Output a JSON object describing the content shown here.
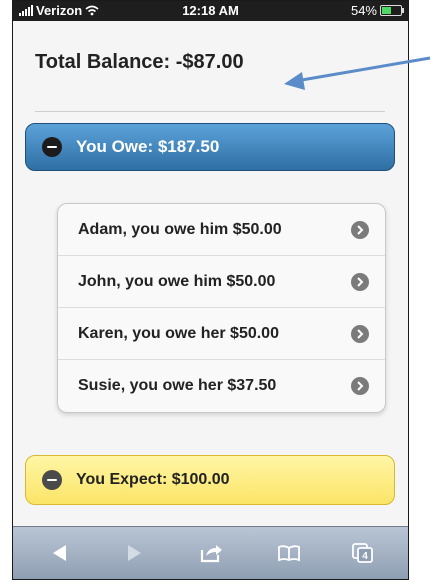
{
  "status": {
    "carrier": "Verizon",
    "time": "12:18 AM",
    "battery": "54%",
    "battery_level": 0.54
  },
  "header": {
    "total_balance": "Total Balance: -$87.00"
  },
  "owe": {
    "label": "You Owe: $187.50",
    "items": [
      {
        "label": "Adam, you owe him $50.00"
      },
      {
        "label": "John, you owe him $50.00"
      },
      {
        "label": "Karen, you owe her $50.00"
      },
      {
        "label": "Susie, you owe her $37.50"
      }
    ]
  },
  "expect": {
    "label": "You Expect: $100.00"
  },
  "toolbar": {
    "tabs_count": "4",
    "icons": [
      "back-icon",
      "forward-icon",
      "share-icon",
      "bookmarks-icon",
      "tabs-icon"
    ]
  },
  "colors": {
    "owe_bar": "#3f7fb8",
    "expect_bar": "#fbe466",
    "annotation_arrow": "#5b8cc9"
  }
}
